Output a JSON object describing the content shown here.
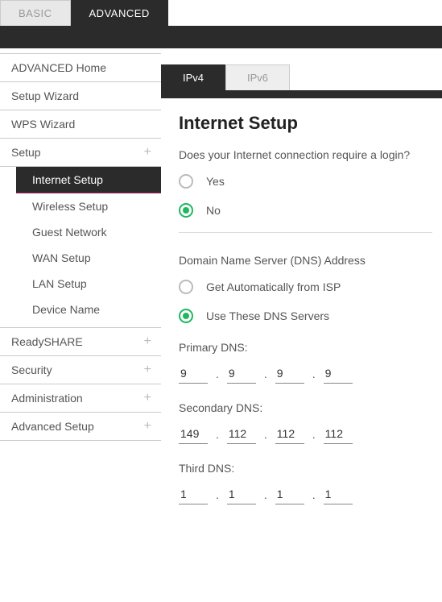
{
  "topTabs": {
    "basic": "BASIC",
    "advanced": "ADVANCED"
  },
  "sidebar": {
    "items": [
      {
        "label": "ADVANCED Home",
        "expandable": false
      },
      {
        "label": "Setup Wizard",
        "expandable": false
      },
      {
        "label": "WPS Wizard",
        "expandable": false
      },
      {
        "label": "Setup",
        "expandable": true
      },
      {
        "label": "ReadySHARE",
        "expandable": true
      },
      {
        "label": "Security",
        "expandable": true
      },
      {
        "label": "Administration",
        "expandable": true
      },
      {
        "label": "Advanced Setup",
        "expandable": true
      }
    ],
    "setupSub": [
      "Internet Setup",
      "Wireless Setup",
      "Guest Network",
      "WAN Setup",
      "LAN Setup",
      "Device Name"
    ]
  },
  "ipTabs": {
    "ipv4": "IPv4",
    "ipv6": "IPv6"
  },
  "page": {
    "title": "Internet Setup",
    "loginQuestion": "Does your Internet connection require a login?",
    "yes": "Yes",
    "no": "No",
    "dnsHeading": "Domain Name Server (DNS) Address",
    "dnsAuto": "Get Automatically from ISP",
    "dnsManual": "Use These DNS Servers",
    "primaryLabel": "Primary DNS:",
    "secondaryLabel": "Secondary DNS:",
    "thirdLabel": "Third DNS:",
    "primary": [
      "9",
      "9",
      "9",
      "9"
    ],
    "secondary": [
      "149",
      "112",
      "112",
      "112"
    ],
    "third": [
      "1",
      "1",
      "1",
      "1"
    ]
  }
}
